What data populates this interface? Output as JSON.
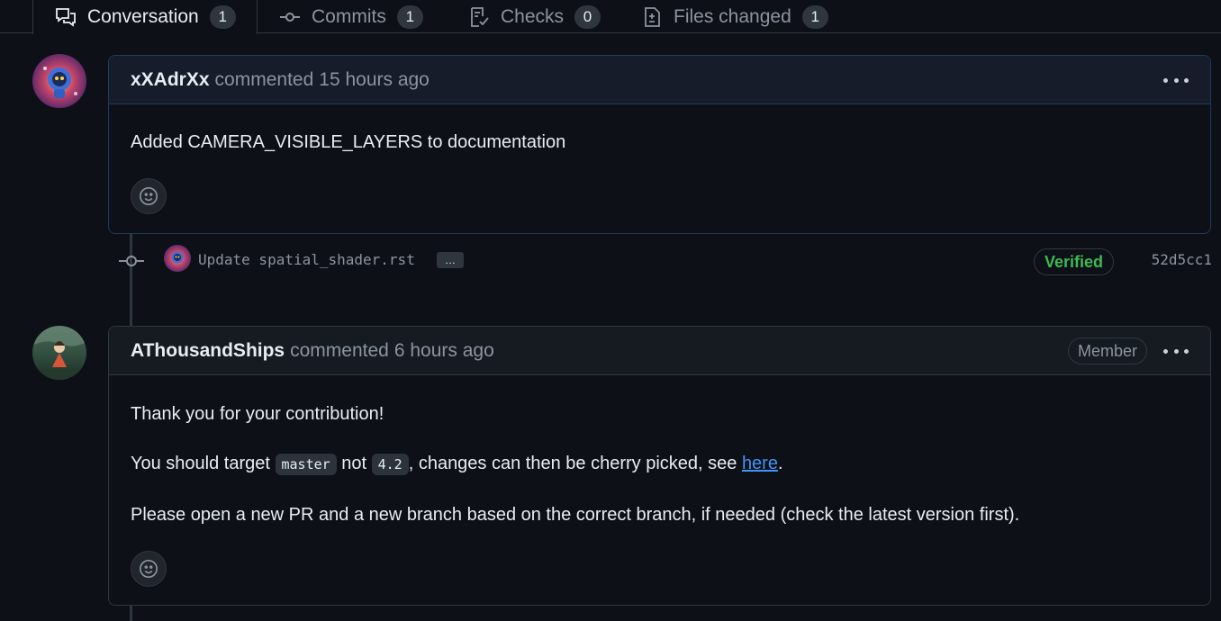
{
  "tabs": [
    {
      "label": "Conversation",
      "count": "1",
      "icon": "comment-discussion-icon"
    },
    {
      "label": "Commits",
      "count": "1",
      "icon": "git-commit-icon"
    },
    {
      "label": "Checks",
      "count": "0",
      "icon": "checklist-icon"
    },
    {
      "label": "Files changed",
      "count": "1",
      "icon": "file-diff-icon"
    }
  ],
  "comments": [
    {
      "user": "xXAdrXx",
      "action": "commented",
      "time": "15 hours ago",
      "body": [
        "Added CAMERA_VISIBLE_LAYERS to documentation"
      ]
    },
    {
      "user": "AThousandShips",
      "action": "commented",
      "time": "6 hours ago",
      "badge": "Member",
      "body_1": "Thank you for your contribution!",
      "body_2": {
        "pre": "You should target ",
        "code_1": "master",
        "mid": " not ",
        "code_2": "4.2",
        "post": ", changes can then be cherry picked, see ",
        "link": "here",
        "end": "."
      },
      "body_3": "Please open a new PR and a new branch based on the correct branch, if needed (check the latest version first)."
    }
  ],
  "commit": {
    "message": "Update spatial_shader.rst",
    "ellipsis": "…",
    "verified": "Verified",
    "sha": "52d5cc1"
  },
  "colors": {
    "background": "#0d1117",
    "link": "#4493f8",
    "verified": "#3fb950",
    "border": "#30363d"
  }
}
